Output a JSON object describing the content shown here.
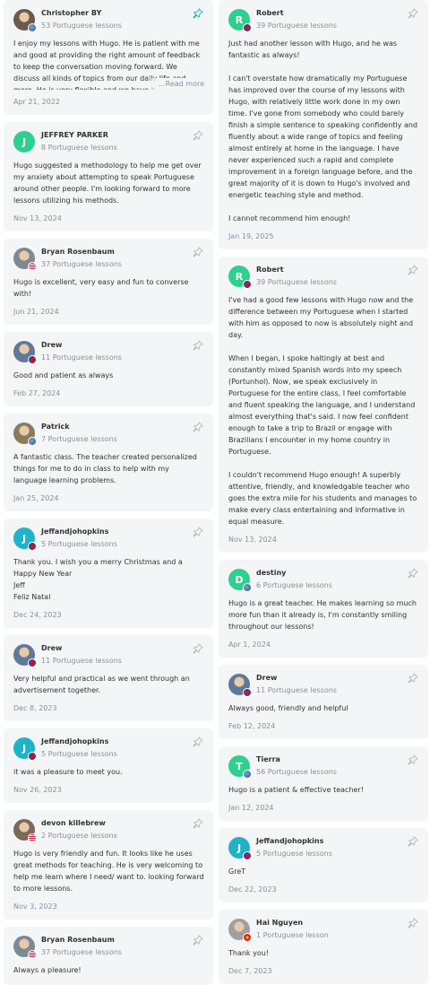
{
  "left": [
    {
      "name": "Christopher BY",
      "lessons": "53 Portuguese lessons",
      "text": "I enjoy my lessons with Hugo. He is patient with me and good at providing the right amount of feedback to keep the conversation moving forward. We discuss all kinds of topics from our daily life and more. He is very flexible and we have been working together to de",
      "more": "...Read more",
      "date": "Apr 21, 2022",
      "avatar": "photo",
      "flag": "sphere",
      "pin": "active"
    },
    {
      "name": "JEFFREY PARKER",
      "lessons": "8 Portuguese lessons",
      "text": "Hugo suggested a methodology to help me get over my anxiety about attempting to speak Portuguese around other people. I'm looking forward to more lessons utilizing his methods.",
      "date": "Nov 13, 2024",
      "avatar": "J",
      "avcolor": "#2fcf8e",
      "flag": "none"
    },
    {
      "name": "Bryan Rosenbaum",
      "lessons": "37 Portuguese lessons",
      "text": "Hugo is excellent, very easy and fun to converse with!",
      "date": "Jun 21, 2024",
      "avatar": "photo",
      "flag": "us"
    },
    {
      "name": "Drew",
      "lessons": "11 Portuguese lessons",
      "text": "Good and patient as always",
      "date": "Feb 27, 2024",
      "avatar": "photo",
      "flag": "uk"
    },
    {
      "name": "Patrick",
      "lessons": "7 Portuguese lessons",
      "text": "A fantastic class. The teacher created personalized things for me to do in class to help with my language learning problems.",
      "date": "Jan 25, 2024",
      "avatar": "photo",
      "flag": "sphere"
    },
    {
      "name": "Jeffandjohopkins",
      "lessons": "5 Portuguese lessons",
      "text": "Thank you. I wish you a merry Christmas and a Happy New Year\nJeff\nFeliz Natal",
      "date": "Dec 24, 2023",
      "avatar": "J",
      "avcolor": "#1fb3c8",
      "flag": "uk"
    },
    {
      "name": "Drew",
      "lessons": "11 Portuguese lessons",
      "text": "Very helpful and practical as we went through an advertisement together.",
      "date": "Dec 8, 2023",
      "avatar": "photo",
      "flag": "uk"
    },
    {
      "name": "Jeffandjohopkins",
      "lessons": "5 Portuguese lessons",
      "text": "it was a pleasure to meet you.",
      "date": "Nov 26, 2023",
      "avatar": "J",
      "avcolor": "#1fb3c8",
      "flag": "uk"
    },
    {
      "name": "devon killebrew",
      "lessons": "2 Portuguese lessons",
      "text": "Hugo is very friendly and fun. It looks like he uses great methods for teaching. He is very welcoming to help me learn where I need/ want to. looking forward to more lessons.",
      "date": "Nov 3, 2023",
      "avatar": "photo",
      "flag": "us"
    },
    {
      "name": "Bryan Rosenbaum",
      "lessons": "37 Portuguese lessons",
      "text": "Always a pleasure!",
      "date": "",
      "avatar": "photo",
      "flag": "us"
    }
  ],
  "right": [
    {
      "name": "Robert",
      "lessons": "39 Portuguese lessons",
      "text": "Just had another lesson with Hugo, and he was fantastic as always!\n\nI can't overstate how dramatically my Portuguese has improved over the course of my lessons with Hugo, with relatively little work done in my own time. I've gone from somebody who could barely finish a simple sentence to speaking confidently and fluently about a wide range of topics and feeling almost entirely at home in the language. I have never experienced such a rapid and complete improvement in a foreign language before, and the great majority of it is down to Hugo's involved and energetic teaching style and method.\n\nI cannot recommend him enough!",
      "date": "Jan 19, 2025",
      "avatar": "R",
      "avcolor": "#2fcf8e",
      "flag": "uk"
    },
    {
      "name": "Robert",
      "lessons": "39 Portuguese lessons",
      "text": "I've had a good few lessons with Hugo now and the difference between my Portuguese when I started with him as opposed to now is absolutely night and day.\n\nWhen I began, I spoke haltingly at best and constantly mixed Spanish words into my speech (Portunhol). Now, we speak exclusively in Portuguese for the entire class, I feel comfortable and fluent speaking the language, and I understand almost everything that's said. I now feel confident enough to take a trip to Brazil or engage with Brazilians I encounter in my home country in Portuguese.\n\nI couldn't recommend Hugo enough! A superbly attentive, friendly, and knowledgable teacher who goes the extra mile for his students and manages to make every class entertaining and informative in equal measure.",
      "date": "Nov 13, 2024",
      "avatar": "R",
      "avcolor": "#2fcf8e",
      "flag": "uk"
    },
    {
      "name": "destiny",
      "lessons": "6 Portuguese lessons",
      "text": "Hugo is a great teacher. He makes learning so much more fun than it already is, I'm constantly smiling throughout our lessons!",
      "date": "Apr 1, 2024",
      "avatar": "D",
      "avcolor": "#2fcf8e",
      "flag": "sphere"
    },
    {
      "name": "Drew",
      "lessons": "11 Portuguese lessons",
      "text": "Always good, friendly and helpful",
      "date": "Feb 12, 2024",
      "avatar": "photo",
      "flag": "uk"
    },
    {
      "name": "Tierra",
      "lessons": "56 Portuguese lessons",
      "text": "Hugo is a patient & effective teacher!",
      "date": "Jan 12, 2024",
      "avatar": "T",
      "avcolor": "#2fcf8e",
      "flag": "sphere"
    },
    {
      "name": "Jeffandjohopkins",
      "lessons": "5 Portuguese lessons",
      "text": "GreT",
      "date": "Dec 22, 2023",
      "avatar": "J",
      "avcolor": "#1fb3c8",
      "flag": "uk"
    },
    {
      "name": "Hai Nguyen",
      "lessons": "1 Portuguese lesson",
      "text": "Thank you!",
      "date": "Dec 7, 2023",
      "avatar": "photo",
      "flag": "vn"
    }
  ],
  "icons": {
    "pin": "pin-icon"
  },
  "colors": {
    "card_bg": "#f4f5f7",
    "accent": "#2bb5c8",
    "green_avatar": "#2fcf8e"
  }
}
